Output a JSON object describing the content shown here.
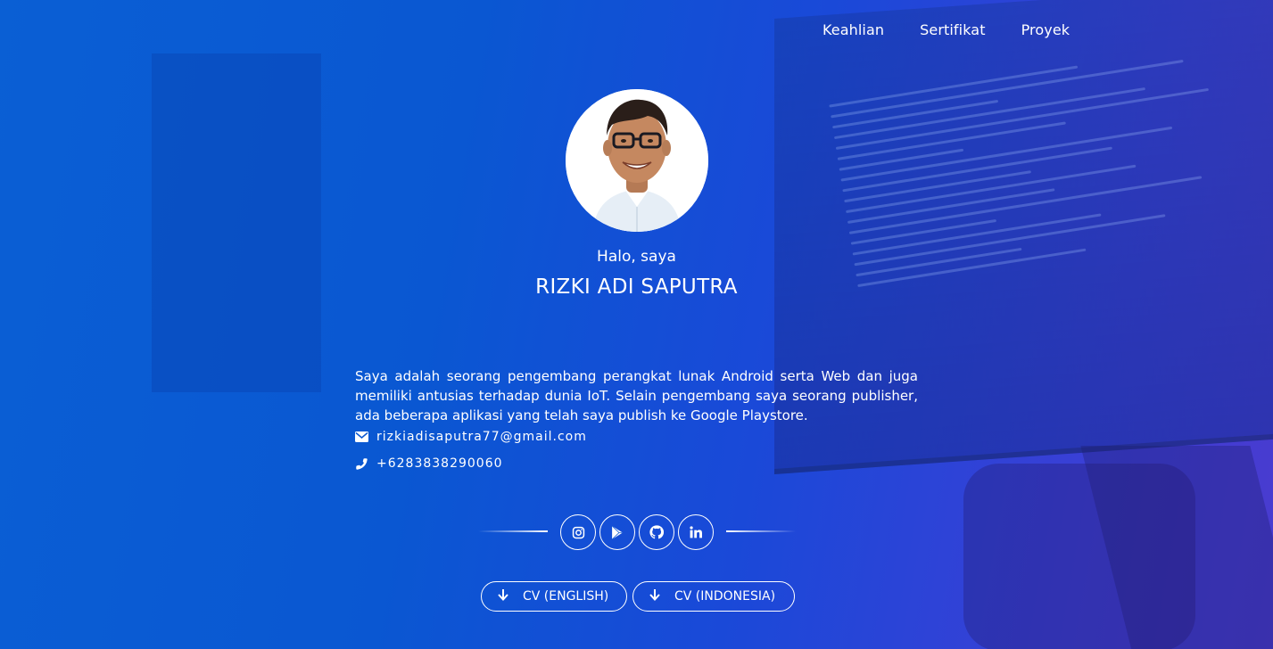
{
  "nav": {
    "items": [
      "Keahlian",
      "Sertifikat",
      "Proyek"
    ]
  },
  "profile": {
    "greeting": "Halo, saya",
    "name": "RIZKI ADI SAPUTRA",
    "bio": "Saya adalah seorang pengembang perangkat lunak Android serta Web dan juga memiliki antusias terhadap dunia IoT. Selain pengembang saya seorang publisher, ada beberapa aplikasi yang telah saya publish ke Google Playstore.",
    "avatar_icon": "profile-photo"
  },
  "contact": {
    "email": "rizkiadisaputra77@gmail.com",
    "email_icon": "envelope-icon",
    "phone": "+6283838290060",
    "phone_icon": "phone-icon"
  },
  "social": {
    "icons": [
      "instagram-icon",
      "google-play-icon",
      "github-icon",
      "linkedin-icon"
    ]
  },
  "cv": {
    "english_label": "CV (ENGLISH)",
    "indonesia_label": "CV (INDONESIA)",
    "icon": "arrow-down-icon"
  },
  "colors": {
    "background_start": "#0a5fd4",
    "background_end": "#4a3bcf",
    "foreground": "#ffffff"
  }
}
